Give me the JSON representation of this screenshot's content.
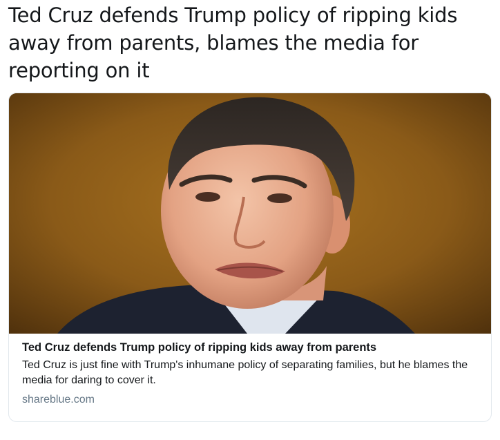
{
  "tweet": {
    "text": "Ted Cruz defends Trump policy of ripping kids away from parents, blames the media for reporting on it"
  },
  "card": {
    "image_icon": "portrait-photo",
    "title": "Ted Cruz defends Trump policy of ripping kids away from parents",
    "description": "Ted Cruz is just fine with Trump's inhumane policy of separating families, but he blames the media for daring to cover it.",
    "domain": "shareblue.com"
  },
  "colors": {
    "text": "#14171a",
    "muted": "#657786",
    "border": "#e1e8ed"
  }
}
